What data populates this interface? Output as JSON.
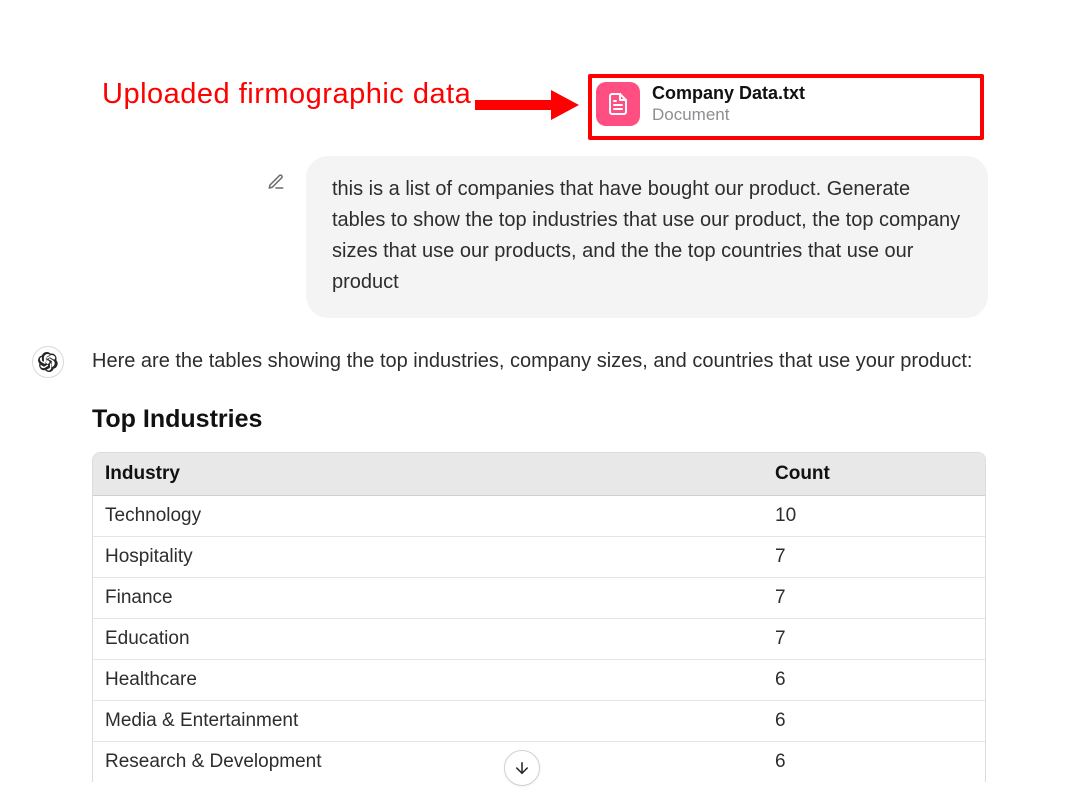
{
  "annotation": {
    "label": "Uploaded firmographic data"
  },
  "attachment": {
    "name": "Company Data.txt",
    "kind": "Document",
    "icon": "document-icon"
  },
  "user": {
    "edit_icon": "pencil-icon",
    "message": "this is a list of companies that have bought our product. Generate tables to show the top industries that use our product, the top company sizes that use our products, and the the top countries that use our product"
  },
  "assistant": {
    "avatar_icon": "openai-logo",
    "intro": "Here are the tables showing the top industries, company sizes, and countries that use your product:",
    "section_title": "Top Industries",
    "table": {
      "columns": [
        "Industry",
        "Count"
      ],
      "rows": [
        {
          "industry": "Technology",
          "count": "10"
        },
        {
          "industry": "Hospitality",
          "count": "7"
        },
        {
          "industry": "Finance",
          "count": "7"
        },
        {
          "industry": "Education",
          "count": "7"
        },
        {
          "industry": "Healthcare",
          "count": "6"
        },
        {
          "industry": "Media & Entertainment",
          "count": "6"
        },
        {
          "industry": "Research & Development",
          "count": "6"
        }
      ]
    }
  },
  "scroll_button_icon": "arrow-down-icon"
}
